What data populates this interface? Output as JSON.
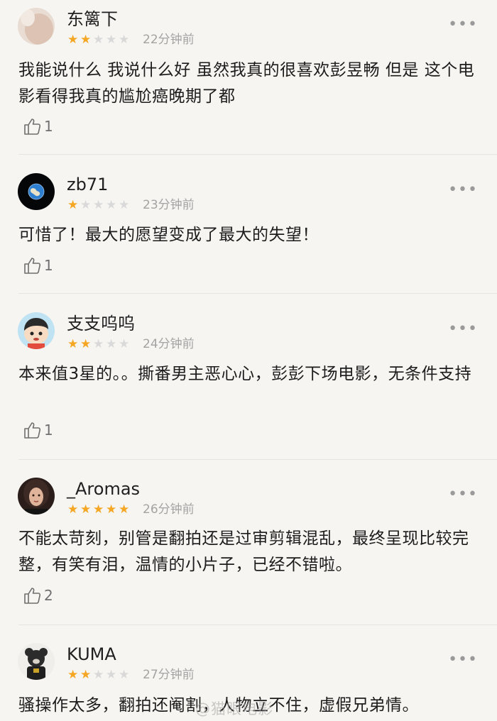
{
  "reviews": [
    {
      "username": "东篱下",
      "rating": 2,
      "time": "22分钟前",
      "text": "我能说什么 我说什么好 虽然我真的很喜欢彭昱畅 但是 这个电影看得我真的尴尬癌晚期了都",
      "likes": "1",
      "avatar_icon": "person-face-avatar-icon"
    },
    {
      "username": "zb71",
      "rating": 1,
      "time": "23分钟前",
      "text": "可惜了！最大的愿望变成了最大的失望！",
      "likes": "1",
      "avatar_icon": "earth-avatar-icon"
    },
    {
      "username": "支支呜呜",
      "rating": 2,
      "time": "24分钟前",
      "text": "本来值3星的。。撕番男主恶心心，彭彭下场电影，无条件支持",
      "likes": "1",
      "avatar_icon": "cartoon-boy-avatar-icon"
    },
    {
      "username": "_Aromas",
      "rating": 5,
      "time": "26分钟前",
      "text": "不能太苛刻，别管是翻拍还是过审剪辑混乱，最终呈现比较完整，有笑有泪，温情的小片子，已经不错啦。",
      "likes": "2",
      "avatar_icon": "woman-portrait-avatar-icon"
    },
    {
      "username": "KUMA",
      "rating": 2,
      "time": "27分钟前",
      "text": "骚操作太多，翻拍还阉割，人物立不住，虚假兄弟情。",
      "likes": "",
      "avatar_icon": "bear-figure-avatar-icon"
    }
  ],
  "max_rating": 5,
  "more_label": "•••",
  "watermark": "@猫眼电影",
  "colors": {
    "star_on": "#f5a623",
    "star_off": "#d9d9d9",
    "background": "#f6f5f1"
  }
}
